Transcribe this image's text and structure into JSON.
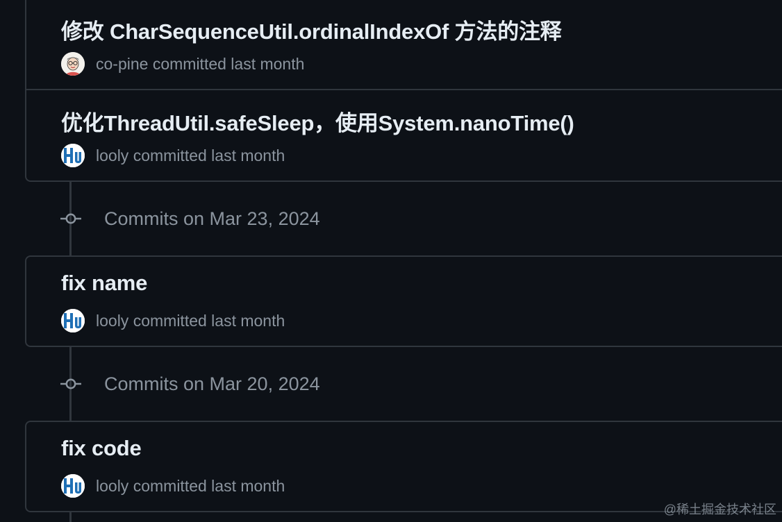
{
  "groups": [
    {
      "commits": [
        {
          "title": "修改 CharSequenceUtil.ordinalIndexOf 方法的注释",
          "author": "co-pine",
          "action": "committed last month",
          "avatar": "cartoon-avatar-icon"
        },
        {
          "title": "优化ThreadUtil.safeSleep，使用System.nanoTime()",
          "author": "looly",
          "action": "committed last month",
          "avatar": "hutool-logo-avatar"
        }
      ]
    },
    {
      "date_label": "Commits on Mar 23, 2024",
      "commits": [
        {
          "title": "fix name",
          "author": "looly",
          "action": "committed last month",
          "avatar": "hutool-logo-avatar"
        }
      ]
    },
    {
      "date_label": "Commits on Mar 20, 2024",
      "commits": [
        {
          "title": "fix code",
          "author": "looly",
          "action": "committed last month",
          "avatar": "hutool-logo-avatar"
        }
      ]
    }
  ],
  "watermark": "@稀土掘金技术社区",
  "colors": {
    "background": "#0d1117",
    "border": "#30363d",
    "text_primary": "#e6edf3",
    "text_muted": "#8b949e",
    "hutool_blue": "#1f6fb5"
  }
}
